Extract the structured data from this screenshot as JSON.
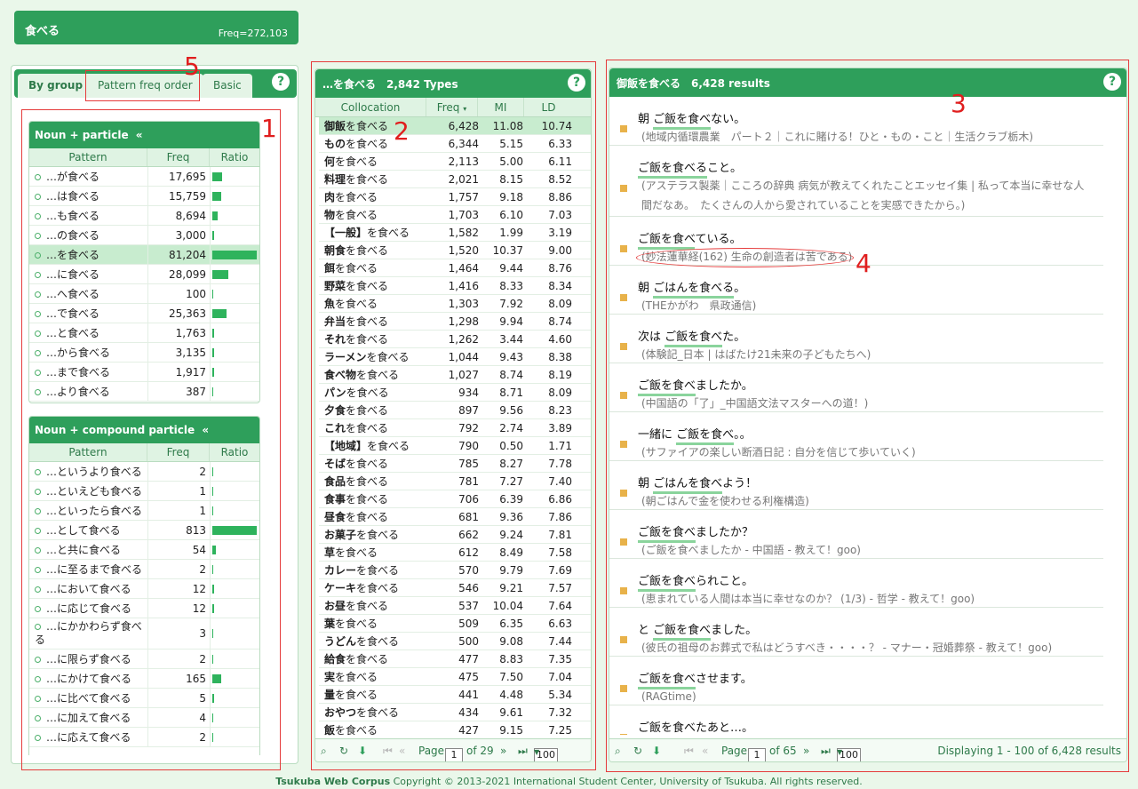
{
  "top": {
    "title": "食べる",
    "freq": "Freq=272,103"
  },
  "tabs": {
    "by_group": "By group",
    "pattern_freq": "Pattern freq order",
    "basic": "Basic"
  },
  "help": "?",
  "group1": {
    "title": "Noun + particle",
    "collapse": "«",
    "headers": {
      "pattern": "Pattern",
      "freq": "Freq",
      "ratio": "Ratio"
    },
    "rows": [
      {
        "p": "…が食べる",
        "f": "17,695",
        "ratio": 0.22
      },
      {
        "p": "…は食べる",
        "f": "15,759",
        "ratio": 0.19
      },
      {
        "p": "…も食べる",
        "f": "8,694",
        "ratio": 0.11
      },
      {
        "p": "…の食べる",
        "f": "3,000",
        "ratio": 0.04
      },
      {
        "p": "…を食べる",
        "f": "81,204",
        "ratio": 1.0
      },
      {
        "p": "…に食べる",
        "f": "28,099",
        "ratio": 0.35
      },
      {
        "p": "…へ食べる",
        "f": "100",
        "ratio": 0.0
      },
      {
        "p": "…で食べる",
        "f": "25,363",
        "ratio": 0.31
      },
      {
        "p": "…と食べる",
        "f": "1,763",
        "ratio": 0.02
      },
      {
        "p": "…から食べる",
        "f": "3,135",
        "ratio": 0.04
      },
      {
        "p": "…まで食べる",
        "f": "1,917",
        "ratio": 0.02
      },
      {
        "p": "…より食べる",
        "f": "387",
        "ratio": 0.0
      }
    ]
  },
  "group2": {
    "title": "Noun + compound particle",
    "collapse": "«",
    "headers": {
      "pattern": "Pattern",
      "freq": "Freq",
      "ratio": "Ratio"
    },
    "rows": [
      {
        "p": "…というより食べる",
        "f": "2",
        "ratio": 0.0
      },
      {
        "p": "…といえども食べる",
        "f": "1",
        "ratio": 0.0
      },
      {
        "p": "…といったら食べる",
        "f": "1",
        "ratio": 0.0
      },
      {
        "p": "…として食べる",
        "f": "813",
        "ratio": 1.0
      },
      {
        "p": "…と共に食べる",
        "f": "54",
        "ratio": 0.07
      },
      {
        "p": "…に至るまで食べる",
        "f": "2",
        "ratio": 0.0
      },
      {
        "p": "…において食べる",
        "f": "12",
        "ratio": 0.02
      },
      {
        "p": "…に応じて食べる",
        "f": "12",
        "ratio": 0.02
      },
      {
        "p": "…にかかわらず食べる",
        "f": "3",
        "ratio": 0.0
      },
      {
        "p": "…に限らず食べる",
        "f": "2",
        "ratio": 0.0
      },
      {
        "p": "…にかけて食べる",
        "f": "165",
        "ratio": 0.2
      },
      {
        "p": "…に比べて食べる",
        "f": "5",
        "ratio": 0.01
      },
      {
        "p": "…に加えて食べる",
        "f": "4",
        "ratio": 0.0
      },
      {
        "p": "…に応えて食べる",
        "f": "2",
        "ratio": 0.0
      }
    ]
  },
  "middle": {
    "title": "…を食べる　2,842 Types",
    "headers": {
      "col": "Collocation",
      "freq": "Freq",
      "mi": "MI",
      "ld": "LD"
    },
    "rows": [
      {
        "n": "御飯",
        "v": "を食べる",
        "f": "6,428",
        "mi": "11.08",
        "ld": "10.74"
      },
      {
        "n": "もの",
        "v": "を食べる",
        "f": "6,344",
        "mi": "5.15",
        "ld": "6.33"
      },
      {
        "n": "何",
        "v": "を食べる",
        "f": "2,113",
        "mi": "5.00",
        "ld": "6.11"
      },
      {
        "n": "料理",
        "v": "を食べる",
        "f": "2,021",
        "mi": "8.15",
        "ld": "8.52"
      },
      {
        "n": "肉",
        "v": "を食べる",
        "f": "1,757",
        "mi": "9.18",
        "ld": "8.86"
      },
      {
        "n": "物",
        "v": "を食べる",
        "f": "1,703",
        "mi": "6.10",
        "ld": "7.03"
      },
      {
        "n": "【一般】",
        "v": "を食べる",
        "f": "1,582",
        "mi": "1.99",
        "ld": "3.19"
      },
      {
        "n": "朝食",
        "v": "を食べる",
        "f": "1,520",
        "mi": "10.37",
        "ld": "9.00"
      },
      {
        "n": "餌",
        "v": "を食べる",
        "f": "1,464",
        "mi": "9.44",
        "ld": "8.76"
      },
      {
        "n": "野菜",
        "v": "を食べる",
        "f": "1,416",
        "mi": "8.33",
        "ld": "8.34"
      },
      {
        "n": "魚",
        "v": "を食べる",
        "f": "1,303",
        "mi": "7.92",
        "ld": "8.09"
      },
      {
        "n": "弁当",
        "v": "を食べる",
        "f": "1,298",
        "mi": "9.94",
        "ld": "8.74"
      },
      {
        "n": "それ",
        "v": "を食べる",
        "f": "1,262",
        "mi": "3.44",
        "ld": "4.60"
      },
      {
        "n": "ラーメン",
        "v": "を食べる",
        "f": "1,044",
        "mi": "9.43",
        "ld": "8.38"
      },
      {
        "n": "食べ物",
        "v": "を食べる",
        "f": "1,027",
        "mi": "8.74",
        "ld": "8.19"
      },
      {
        "n": "パン",
        "v": "を食べる",
        "f": "934",
        "mi": "8.71",
        "ld": "8.09"
      },
      {
        "n": "夕食",
        "v": "を食べる",
        "f": "897",
        "mi": "9.56",
        "ld": "8.23"
      },
      {
        "n": "これ",
        "v": "を食べる",
        "f": "792",
        "mi": "2.74",
        "ld": "3.89"
      },
      {
        "n": "【地域】",
        "v": "を食べる",
        "f": "790",
        "mi": "0.50",
        "ld": "1.71"
      },
      {
        "n": "そば",
        "v": "を食べる",
        "f": "785",
        "mi": "8.27",
        "ld": "7.78"
      },
      {
        "n": "食品",
        "v": "を食べる",
        "f": "781",
        "mi": "7.27",
        "ld": "7.40"
      },
      {
        "n": "食事",
        "v": "を食べる",
        "f": "706",
        "mi": "6.39",
        "ld": "6.86"
      },
      {
        "n": "昼食",
        "v": "を食べる",
        "f": "681",
        "mi": "9.36",
        "ld": "7.86"
      },
      {
        "n": "お菓子",
        "v": "を食べる",
        "f": "662",
        "mi": "9.24",
        "ld": "7.81"
      },
      {
        "n": "草",
        "v": "を食べる",
        "f": "612",
        "mi": "8.49",
        "ld": "7.58"
      },
      {
        "n": "カレー",
        "v": "を食べる",
        "f": "570",
        "mi": "9.79",
        "ld": "7.69"
      },
      {
        "n": "ケーキ",
        "v": "を食べる",
        "f": "546",
        "mi": "9.21",
        "ld": "7.57"
      },
      {
        "n": "お昼",
        "v": "を食べる",
        "f": "537",
        "mi": "10.04",
        "ld": "7.64"
      },
      {
        "n": "葉",
        "v": "を食べる",
        "f": "509",
        "mi": "6.35",
        "ld": "6.63"
      },
      {
        "n": "うどん",
        "v": "を食べる",
        "f": "500",
        "mi": "9.08",
        "ld": "7.44"
      },
      {
        "n": "給食",
        "v": "を食べる",
        "f": "477",
        "mi": "8.83",
        "ld": "7.35"
      },
      {
        "n": "実",
        "v": "を食べる",
        "f": "475",
        "mi": "7.50",
        "ld": "7.04"
      },
      {
        "n": "量",
        "v": "を食べる",
        "f": "441",
        "mi": "4.48",
        "ld": "5.34"
      },
      {
        "n": "おやつ",
        "v": "を食べる",
        "f": "434",
        "mi": "9.61",
        "ld": "7.32"
      },
      {
        "n": "飯",
        "v": "を食べる",
        "f": "427",
        "mi": "9.15",
        "ld": "7.25"
      }
    ],
    "pager": {
      "page_label": "Page",
      "page": "1",
      "of": "of 29",
      "size": "100"
    }
  },
  "right": {
    "title": "御飯を食べる　6,428 results",
    "results": [
      {
        "pre": "朝 ",
        "hl": "ご飯を食べ",
        "post": "ない。",
        "src": "(地域内循環農業　パート２｜これに賭ける！ひと・もの・こと｜生活クラブ栃木)"
      },
      {
        "pre": "",
        "hl": "ご飯を食べる",
        "post": "こと。",
        "src": "(アステラス製薬｜こころの辞典 病気が教えてくれたことエッセイ集 | 私って本当に幸せな人間だなあ。　たくさんの人から愛されていることを実感できたから。)"
      },
      {
        "pre": "",
        "hl": "ご飯を食べ",
        "post": "ている。",
        "src": "(妙法蓮華経(162) 生命の創造者は苦である)"
      },
      {
        "pre": "朝 ",
        "hl": "ごはんを食べる",
        "post": "。",
        "src": "(THEかがわ　県政通信)"
      },
      {
        "pre": "次は ",
        "hl": "ご飯を食べ",
        "post": "た。",
        "src": "(体験記_日本 | はばたけ21未来の子どもたちへ)"
      },
      {
        "pre": "",
        "hl": "ご飯を食べ",
        "post": "ましたか。",
        "src": "(中国語の「了」_中国語文法マスターへの道！)"
      },
      {
        "pre": "一緒に ",
        "hl": "ご飯を食べ",
        "post": "。。",
        "src": "(サファイアの楽しい断酒日記 : 自分を信じて歩いていく)"
      },
      {
        "pre": "朝 ",
        "hl": "ごはんを食べ",
        "post": "よう！",
        "src": "(朝ごはんで金を使わせる利権構造)"
      },
      {
        "pre": "",
        "hl": "ご飯を食べ",
        "post": "ましたか？",
        "src": "(ご飯を食べましたか - 中国語 - 教えて！goo)"
      },
      {
        "pre": "",
        "hl": "ご飯を食べ",
        "post": "られこと。",
        "src": "(恵まれている人間は本当に幸せなのか？ (1/3) - 哲学 - 教えて！goo)"
      },
      {
        "pre": "と ",
        "hl": "ご飯を食べ",
        "post": "ました。",
        "src": "(彼氏の祖母のお葬式で私はどうすべき・・・・？ - マナー・冠婚葬祭 - 教えて！goo)"
      },
      {
        "pre": "",
        "hl": "ご飯を食べ",
        "post": "させます。",
        "src": "(RAGtime)"
      },
      {
        "pre": "",
        "hl": "ご飯を食べ",
        "post": "たあと…。",
        "src": ""
      }
    ],
    "pager": {
      "page_label": "Page",
      "page": "1",
      "of": "of 65",
      "size": "100",
      "display": "Displaying 1 - 100 of 6,428 results"
    }
  },
  "annotations": [
    "1",
    "2",
    "3",
    "4",
    "5"
  ],
  "footer": {
    "brand": "Tsukuba Web Corpus",
    "text": " Copyright © 2013-2021 International Student Center, University of Tsukuba. All rights reserved."
  },
  "colors": {
    "header": "#2e9f5b",
    "bar": "#2eb35c",
    "marker": "#e8b24a",
    "annot": "#e01e1e"
  }
}
